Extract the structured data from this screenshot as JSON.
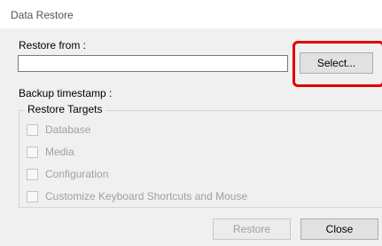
{
  "window": {
    "title": "Data Restore"
  },
  "restore_from": {
    "label": "Restore from :",
    "value": "",
    "select_label": "Select..."
  },
  "backup": {
    "label": "Backup timestamp :"
  },
  "targets": {
    "legend": "Restore Targets",
    "items": [
      {
        "label": "Database",
        "checked": false,
        "enabled": false
      },
      {
        "label": "Media",
        "checked": false,
        "enabled": false
      },
      {
        "label": "Configuration",
        "checked": false,
        "enabled": false
      },
      {
        "label": "Customize Keyboard Shortcuts and Mouse",
        "checked": false,
        "enabled": false
      }
    ]
  },
  "footer": {
    "restore_label": "Restore",
    "close_label": "Close"
  },
  "colors": {
    "highlight": "#e00000",
    "disabled_text": "#a0a0a0"
  }
}
